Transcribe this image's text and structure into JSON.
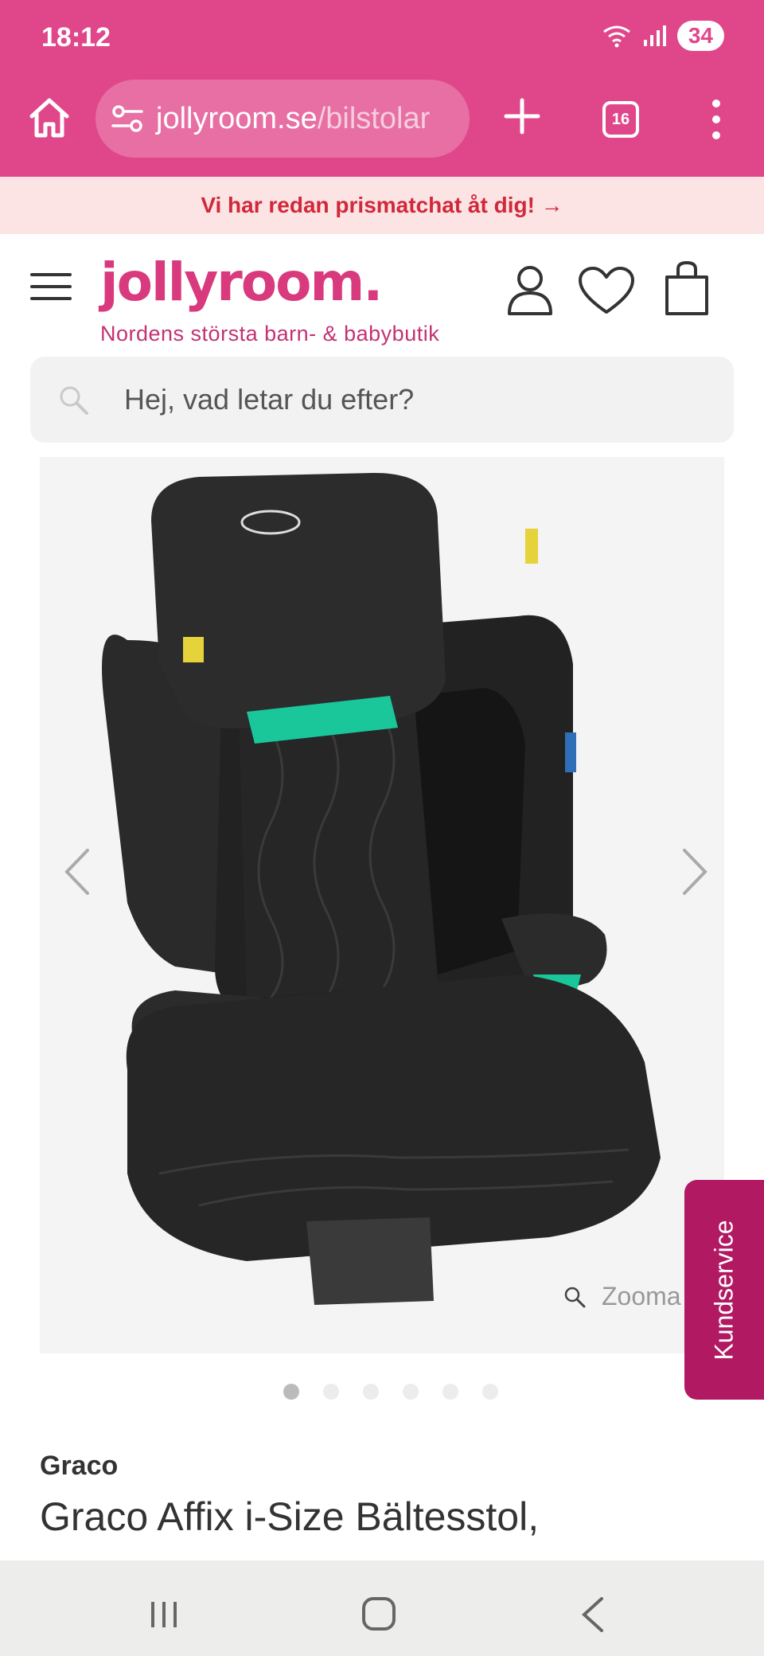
{
  "status_bar": {
    "time": "18:12",
    "battery": "34",
    "wifi_icon": "wifi-icon",
    "signal_icon": "signal-icon"
  },
  "browser": {
    "url_host": "jollyroom.se",
    "url_path": "/bilstolar",
    "tab_count": "16"
  },
  "promo": {
    "text": "Vi har redan prismatchat åt dig! →"
  },
  "header": {
    "logo": "jollyroom.",
    "tagline": "Nordens största barn- & babybutik"
  },
  "search": {
    "placeholder": "Hej, vad letar du efter?"
  },
  "gallery": {
    "zoom_label": "Zooma",
    "image_count": 6,
    "active_index": 0
  },
  "support": {
    "label": "Kundservice"
  },
  "product": {
    "brand": "Graco",
    "title": "Graco Affix i-Size Bältesstol,"
  },
  "colors": {
    "chrome": "#e0478a",
    "brand_pink": "#d93a7d",
    "promo_bg": "#fde4e4",
    "promo_text": "#d1283a",
    "kundservice": "#b11a63",
    "seat_teal": "#19c79a"
  }
}
